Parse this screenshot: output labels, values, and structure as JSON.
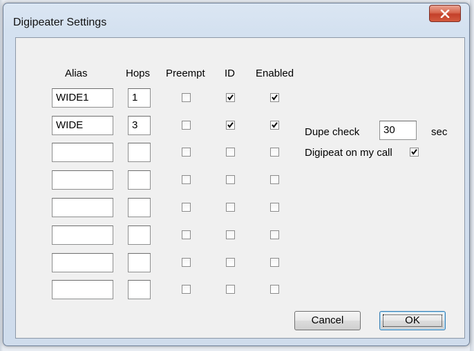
{
  "window": {
    "title": "Digipeater Settings",
    "close_label": "x"
  },
  "headers": {
    "alias": "Alias",
    "hops": "Hops",
    "preempt": "Preempt",
    "id": "ID",
    "enabled": "Enabled"
  },
  "rows": [
    {
      "alias": "WIDE1",
      "hops": "1",
      "preempt": false,
      "id": true,
      "enabled": true
    },
    {
      "alias": "WIDE",
      "hops": "3",
      "preempt": false,
      "id": true,
      "enabled": true
    },
    {
      "alias": "",
      "hops": "",
      "preempt": false,
      "id": false,
      "enabled": false
    },
    {
      "alias": "",
      "hops": "",
      "preempt": false,
      "id": false,
      "enabled": false
    },
    {
      "alias": "",
      "hops": "",
      "preempt": false,
      "id": false,
      "enabled": false
    },
    {
      "alias": "",
      "hops": "",
      "preempt": false,
      "id": false,
      "enabled": false
    },
    {
      "alias": "",
      "hops": "",
      "preempt": false,
      "id": false,
      "enabled": false
    },
    {
      "alias": "",
      "hops": "",
      "preempt": false,
      "id": false,
      "enabled": false
    }
  ],
  "dupe_check": {
    "label": "Dupe check",
    "value": "30",
    "unit": "sec"
  },
  "digipeat_on_my_call": {
    "label": "Digipeat on my call",
    "checked": true
  },
  "buttons": {
    "cancel": "Cancel",
    "ok": "OK"
  },
  "colors": {
    "close_button": "#c9442b",
    "dialog_bg": "#f0f0f0",
    "frame": "#d4e1f0"
  }
}
